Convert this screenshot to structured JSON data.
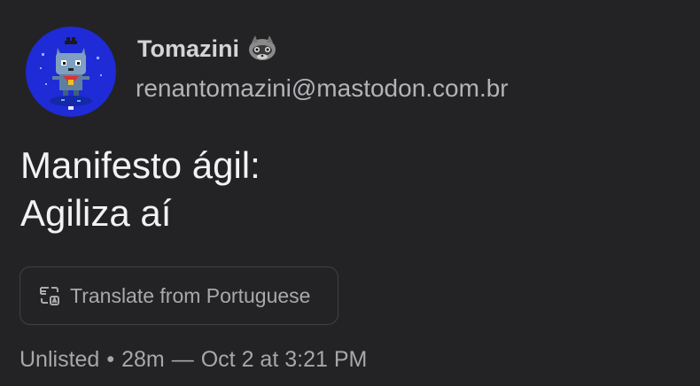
{
  "post": {
    "author": {
      "display_name": "Tomazini",
      "name_emoji": "raccoon-emoji",
      "handle": "renantomazini@mastodon.com.br",
      "avatar": "avatar-pixel-cat"
    },
    "content_lines": [
      "Manifesto ágil:",
      "Agiliza aí"
    ],
    "translate": {
      "label": "Translate from Portuguese",
      "icon": "translate-icon"
    },
    "meta": {
      "visibility": "Unlisted",
      "separator": "•",
      "relative_time": "28m",
      "dash": "—",
      "absolute_time": "Oct 2 at 3:21 PM"
    }
  },
  "colors": {
    "background": "#232325",
    "avatar_bg": "#1f2bd6",
    "text_primary": "#f2f2f3",
    "text_secondary": "#b3b3b7",
    "button_border": "#414145"
  }
}
